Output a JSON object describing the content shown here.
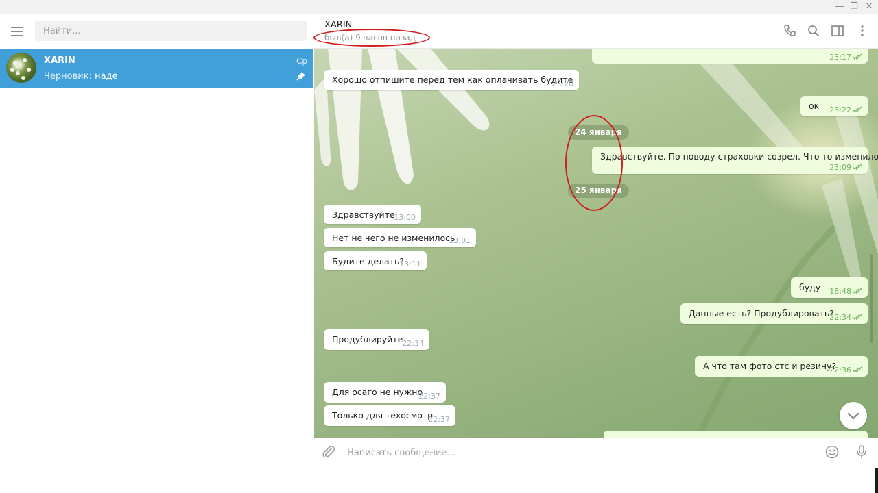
{
  "window": {
    "minimize_glyph": "—",
    "restore_glyph": "❐",
    "close_glyph": "✕"
  },
  "sidebar": {
    "search_placeholder": "Найти...",
    "dialogs": [
      {
        "name": "XARIN",
        "time": "Ср",
        "draft_label": "Черновик:",
        "draft_text": "наде",
        "pinned": true,
        "avatar_icon": "daisy-avatar-icon"
      }
    ]
  },
  "chat_header": {
    "name": "XARIN",
    "status": "был(а) 9 часов назад",
    "icons": [
      "phone-icon",
      "search-icon",
      "sidebar-toggle-icon",
      "more-vertical-icon"
    ]
  },
  "messages": [
    {
      "dir": "out",
      "text": "",
      "time": "23:17",
      "read": true
    },
    {
      "dir": "in",
      "text": "Хорошо отпишите перед тем как оплачивать будите",
      "time": "23:20"
    },
    {
      "dir": "out",
      "text": "ок",
      "time": "23:22",
      "read": true
    },
    {
      "dir": "date",
      "text": "24 января"
    },
    {
      "dir": "out",
      "text": "Здравствуйте. По поводу страховки созрел. Что то изменилось?",
      "time": "23:09",
      "read": true
    },
    {
      "dir": "date",
      "text": "25 января"
    },
    {
      "dir": "in",
      "text": "Здравствуйте",
      "time": "13:00"
    },
    {
      "dir": "in",
      "text": "Нет не чего не изменилось",
      "time": "13:01"
    },
    {
      "dir": "in",
      "text": "Будите делать?",
      "time": "13:11"
    },
    {
      "dir": "out",
      "text": "буду",
      "time": "18:48",
      "read": true
    },
    {
      "dir": "out",
      "text": "Данные есть? Продублировать?",
      "time": "22:34",
      "read": true
    },
    {
      "dir": "in",
      "text": "Продублируйте",
      "time": "22:34"
    },
    {
      "dir": "out",
      "text": "А что там фото стс и резину?",
      "time": "22:36",
      "read": true
    },
    {
      "dir": "in",
      "text": "Для осаго не нужно",
      "time": "22:37"
    },
    {
      "dir": "in",
      "text": "Только для техосмотр",
      "time": "22:37"
    }
  ],
  "compose": {
    "placeholder": "Написать сообщение...",
    "icons": [
      "attach-icon",
      "emoji-icon",
      "microphone-icon"
    ]
  },
  "colors": {
    "accent": "#419fd9",
    "outgoing_bubble": "#effdde",
    "incoming_bubble": "#ffffff",
    "read_check": "#6fb45e",
    "annotation": "#d21d1d"
  }
}
